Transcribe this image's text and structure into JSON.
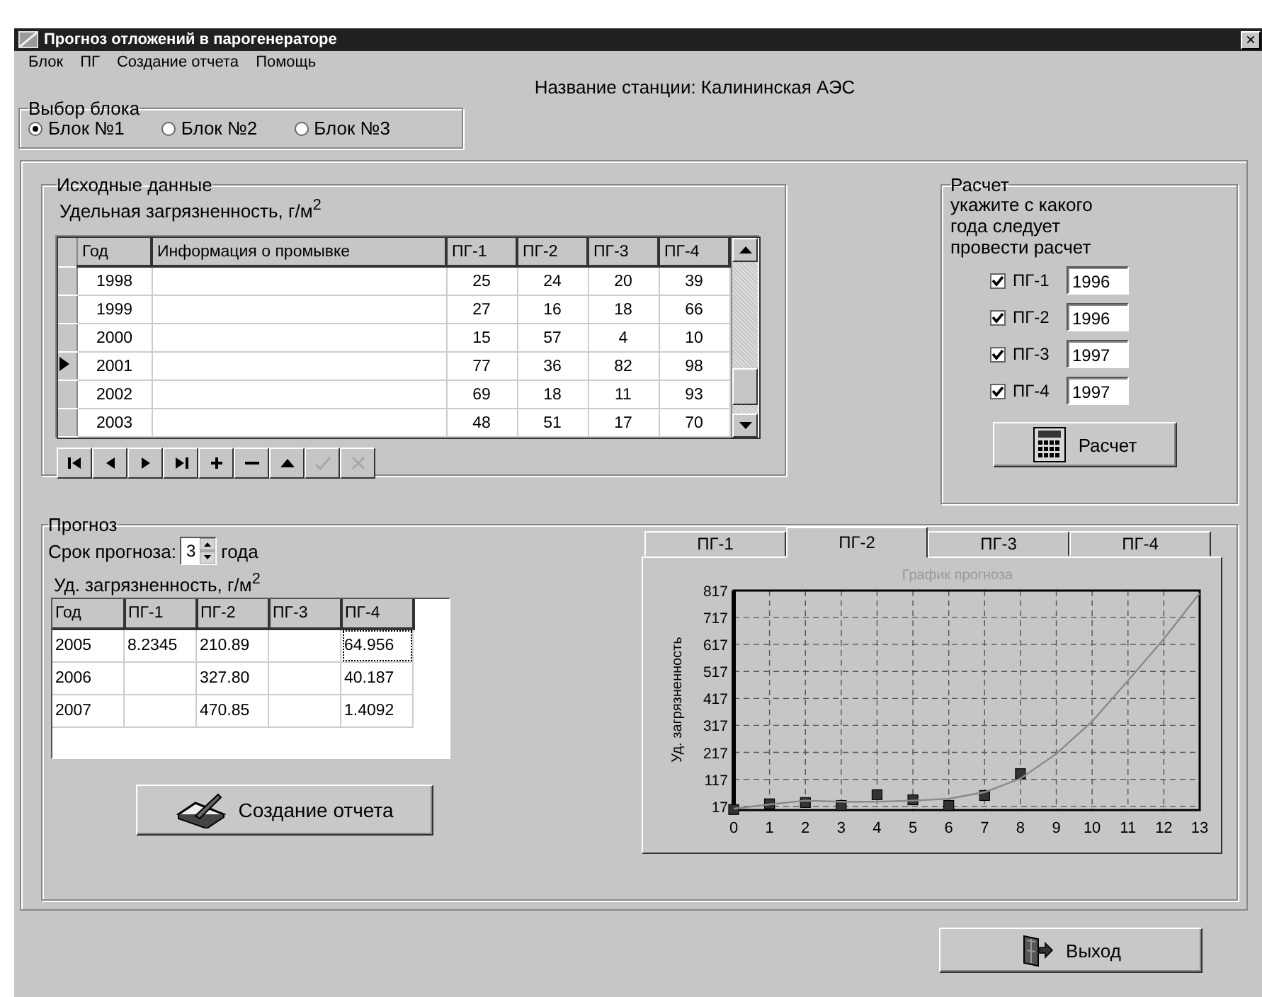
{
  "window": {
    "title": "Прогноз отложений в парогенераторе",
    "close": "×"
  },
  "menu": [
    "Блок",
    "ПГ",
    "Создание отчета",
    "Помощь"
  ],
  "station": "Название станции: Калининская АЭС",
  "block_select": {
    "title": "Выбор блока",
    "options": [
      {
        "label": "Блок №1",
        "selected": true
      },
      {
        "label": "Блок №2",
        "selected": false
      },
      {
        "label": "Блок №3",
        "selected": false
      }
    ]
  },
  "source_data": {
    "title": "Исходные данные",
    "caption": "Удельная загрязненность, г/м$^{2}$",
    "columns": [
      "Год",
      "Информация о промывке",
      "ПГ-1",
      "ПГ-2",
      "ПГ-3",
      "ПГ-4"
    ],
    "rows": [
      {
        "cells": [
          "1998",
          "",
          "25",
          "24",
          "20",
          "39"
        ],
        "selected": false
      },
      {
        "cells": [
          "1999",
          "",
          "27",
          "16",
          "18",
          "66"
        ],
        "selected": false
      },
      {
        "cells": [
          "2000",
          "",
          "15",
          "57",
          "4",
          "10"
        ],
        "selected": false
      },
      {
        "cells": [
          "2001",
          "",
          "77",
          "36",
          "82",
          "98"
        ],
        "selected": true
      },
      {
        "cells": [
          "2002",
          "",
          "69",
          "18",
          "11",
          "93"
        ],
        "selected": false
      },
      {
        "cells": [
          "2003",
          "",
          "48",
          "51",
          "17",
          "70"
        ],
        "selected": false
      }
    ],
    "navigator": [
      {
        "kind": "first",
        "disabled": false
      },
      {
        "kind": "prior",
        "disabled": false
      },
      {
        "kind": "next",
        "disabled": false
      },
      {
        "kind": "last",
        "disabled": false
      },
      {
        "kind": "insert",
        "disabled": false
      },
      {
        "kind": "delete",
        "disabled": false
      },
      {
        "kind": "edit",
        "disabled": false
      },
      {
        "kind": "post",
        "disabled": true
      },
      {
        "kind": "cancel",
        "disabled": true
      }
    ]
  },
  "calculation": {
    "title": "Расчет",
    "hint": "укажите с какого года следует провести расчет",
    "items": [
      {
        "label": "ПГ-1",
        "checked": true,
        "year": "1996"
      },
      {
        "label": "ПГ-2",
        "checked": true,
        "year": "1996"
      },
      {
        "label": "ПГ-3",
        "checked": true,
        "year": "1997"
      },
      {
        "label": "ПГ-4",
        "checked": true,
        "year": "1997"
      }
    ],
    "button": "Расчет"
  },
  "forecast": {
    "title": "Прогноз",
    "term_label": "Срок прогноза:",
    "term": "3",
    "term_unit": "года",
    "caption": "Уд. загрязненность, г/м$^{2}$",
    "columns": [
      "Год",
      "ПГ-1",
      "ПГ-2",
      "ПГ-3",
      "ПГ-4"
    ],
    "rows": [
      {
        "cells": [
          {
            "text": "2005",
            "focused": false
          },
          {
            "text": "8.2345",
            "focused": false
          },
          {
            "text": "210.89",
            "focused": false
          },
          {
            "text": "",
            "focused": false
          },
          {
            "text": "64.956",
            "focused": true
          }
        ]
      },
      {
        "cells": [
          {
            "text": "2006",
            "focused": false
          },
          {
            "text": "",
            "focused": false
          },
          {
            "text": "327.80",
            "focused": false
          },
          {
            "text": "",
            "focused": false
          },
          {
            "text": "40.187",
            "focused": false
          }
        ]
      },
      {
        "cells": [
          {
            "text": "2007",
            "focused": false
          },
          {
            "text": "",
            "focused": false
          },
          {
            "text": "470.85",
            "focused": false
          },
          {
            "text": "",
            "focused": false
          },
          {
            "text": "1.4092",
            "focused": false
          }
        ]
      }
    ],
    "report_button": "Создание отчета",
    "tabs": [
      {
        "label": "ПГ-1",
        "selected": false
      },
      {
        "label": "ПГ-2",
        "selected": true
      },
      {
        "label": "ПГ-3",
        "selected": false
      },
      {
        "label": "ПГ-4",
        "selected": false
      }
    ],
    "chart_data": {
      "type": "line",
      "title": "График прогноза",
      "ylabel": "Уд. загрязненность",
      "x": [
        0,
        1,
        2,
        3,
        4,
        5,
        6,
        7,
        8,
        9,
        10,
        11,
        12,
        13
      ],
      "series": [
        {
          "type": "scatter",
          "color": "#333333",
          "values": [
            5,
            26,
            31,
            20,
            60,
            41,
            20,
            57,
            138,
            null,
            null,
            null,
            null,
            null
          ]
        },
        {
          "type": "line",
          "color": "#8a8a8a",
          "values": [
            8,
            24,
            38,
            34,
            34,
            38,
            45,
            69,
            120,
            212,
            332,
            483,
            638,
            807
          ]
        }
      ],
      "xlim": [
        0,
        13
      ],
      "ylim": [
        3,
        817
      ],
      "grid": true,
      "xticks": [
        0,
        1,
        2,
        3,
        4,
        5,
        6,
        7,
        8,
        9,
        10,
        11,
        12,
        13
      ],
      "yticks": [
        17,
        117,
        217,
        317,
        417,
        517,
        617,
        717,
        817
      ]
    }
  },
  "exit_button": "Выход"
}
